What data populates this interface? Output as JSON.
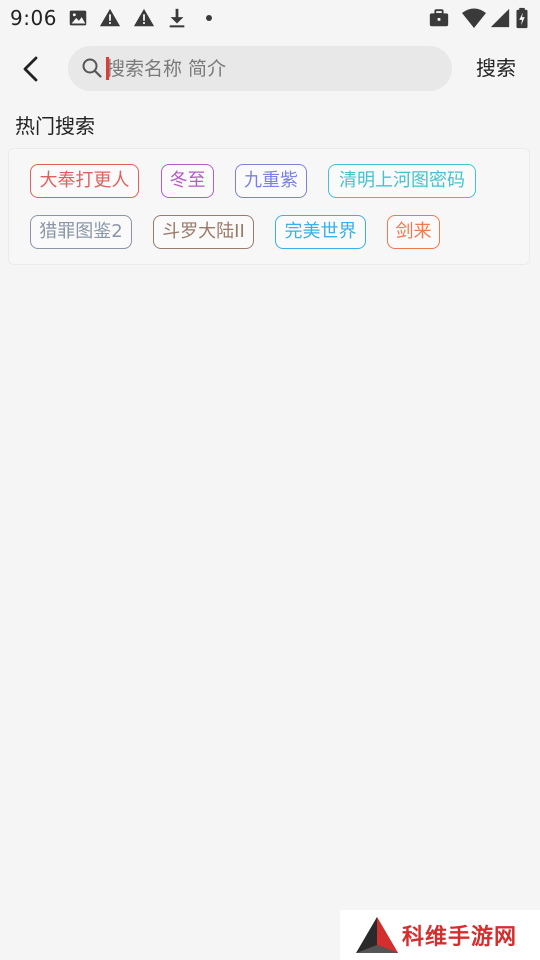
{
  "status_bar": {
    "time": "9:06",
    "icons": [
      "image-icon",
      "warning-icon",
      "warning-icon",
      "download-icon",
      "dot-icon",
      "briefcase-icon",
      "wifi-icon",
      "signal-icon",
      "battery-icon"
    ]
  },
  "header": {
    "back_icon": "chevron-left-icon",
    "search_placeholder": "搜索名称 简介",
    "search_value": "",
    "search_button_label": "搜索"
  },
  "hot_search": {
    "title": "热门搜索",
    "tags": [
      {
        "label": "大奉打更人",
        "color": "#e0605e"
      },
      {
        "label": "冬至",
        "color": "#b45cc8"
      },
      {
        "label": "九重紫",
        "color": "#7a82e0"
      },
      {
        "label": "清明上河图密码",
        "color": "#45c2cc"
      },
      {
        "label": "猎罪图鉴2",
        "color": "#8a96a8"
      },
      {
        "label": "斗罗大陆II",
        "color": "#9a7a6a"
      },
      {
        "label": "完美世界",
        "color": "#3bb0e6"
      },
      {
        "label": "剑来",
        "color": "#f07850"
      }
    ]
  },
  "watermark": {
    "text": "科维手游网",
    "color": "#d32f2f"
  }
}
